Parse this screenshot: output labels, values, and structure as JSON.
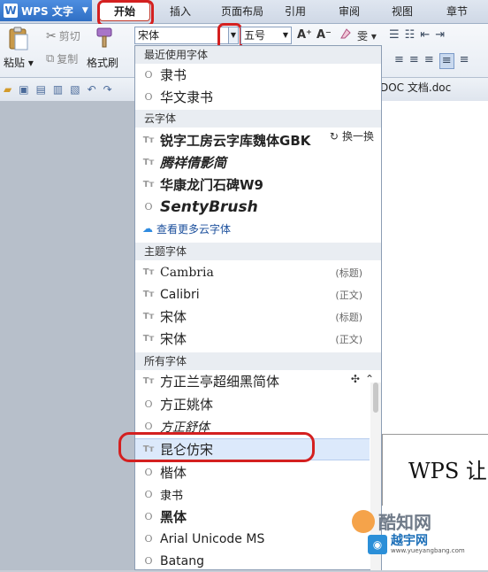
{
  "app": {
    "name": "WPS 文字",
    "logo_letter": "W"
  },
  "tabs": [
    "开始",
    "插入",
    "页面布局",
    "引用",
    "审阅",
    "视图",
    "章节"
  ],
  "ribbon": {
    "paste": "粘贴",
    "cut": "剪切",
    "copy": "复制",
    "format_painter": "格式刷",
    "font_name": "宋体",
    "font_size": "五号",
    "grow_font": "A⁺",
    "shrink_font": "A⁻",
    "phonetic": "雯"
  },
  "document": {
    "tab_title": "DOC 文档.doc",
    "body_text": "WPS 让"
  },
  "font_panel": {
    "recent": {
      "header": "最近使用字体",
      "items": [
        {
          "name": "隶书",
          "icon": "O"
        },
        {
          "name": "华文隶书",
          "icon": "O"
        }
      ]
    },
    "cloud": {
      "header": "云字体",
      "swap": "换一换",
      "items": [
        {
          "name": "锐字工房云字库魏体GBK",
          "icon": "Tт"
        },
        {
          "name": "腾祥倩影简",
          "icon": "Tт"
        },
        {
          "name": "华康龙门石碑W9",
          "icon": "Tт"
        },
        {
          "name": "SentyBrush",
          "icon": "O"
        }
      ],
      "more": "查看更多云字体"
    },
    "theme": {
      "header": "主题字体",
      "items": [
        {
          "name": "Cambria",
          "tag": "(标题)",
          "icon": "Tт"
        },
        {
          "name": "Calibri",
          "tag": "(正文)",
          "icon": "Tт"
        },
        {
          "name": "宋体",
          "tag": "(标题)",
          "icon": "Tт"
        },
        {
          "name": "宋体",
          "tag": "(正文)",
          "icon": "Tт"
        }
      ]
    },
    "all": {
      "header": "所有字体",
      "items": [
        {
          "name": "方正兰亭超细黑简体",
          "icon": "Tт"
        },
        {
          "name": "方正姚体",
          "icon": "O"
        },
        {
          "name": "方正舒体",
          "icon": "O"
        },
        {
          "name": "昆仑仿宋",
          "icon": "Tт"
        },
        {
          "name": "楷体",
          "icon": "O"
        },
        {
          "name": "隶书",
          "icon": "O"
        },
        {
          "name": "黑体",
          "icon": "O"
        },
        {
          "name": "Arial Unicode MS",
          "icon": "O"
        },
        {
          "name": "Batang",
          "icon": "O"
        }
      ]
    }
  },
  "watermarks": {
    "w1": "酷知网",
    "w2": "越宇网",
    "w2_url": "www.yueyangbang.com"
  },
  "colors": {
    "accent_red": "#d42020",
    "hover_blue": "#dce9fb",
    "ribbon_blue": "#2f6fc4"
  }
}
